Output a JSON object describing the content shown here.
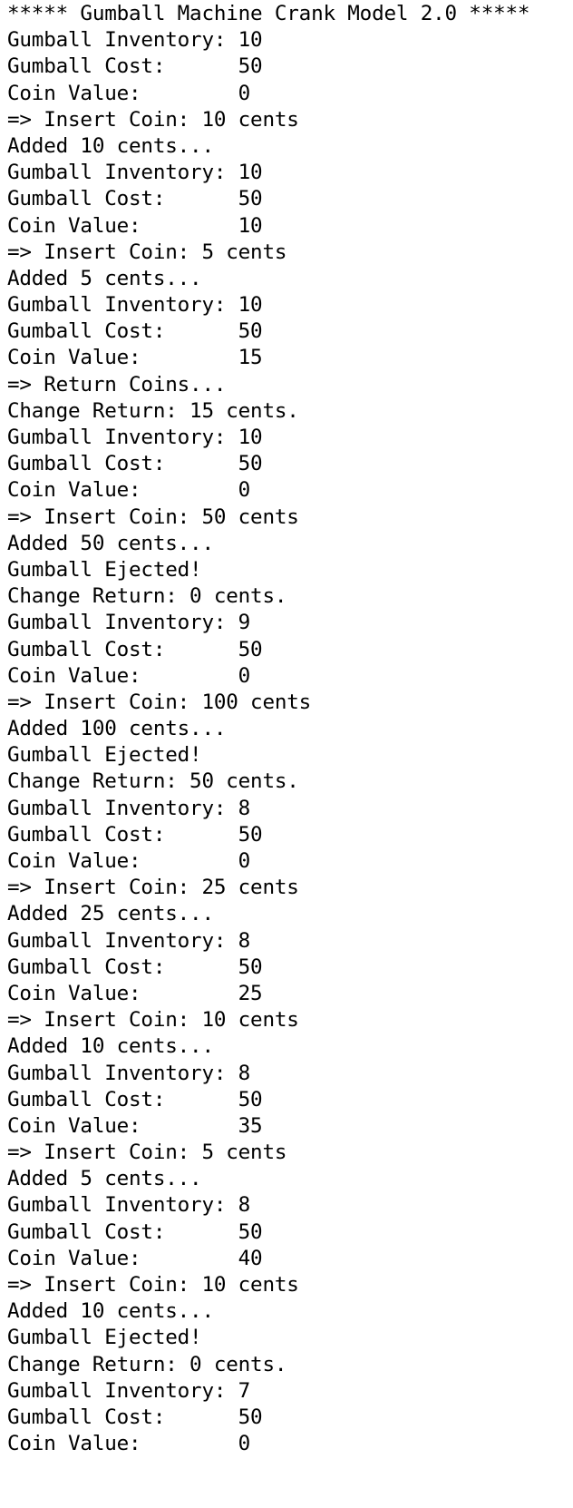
{
  "terminal": {
    "lines": [
      "***** Gumball Machine Crank Model 2.0 *****",
      "Gumball Inventory: 10",
      "Gumball Cost:      50",
      "Coin Value:        0",
      "=> Insert Coin: 10 cents",
      "Added 10 cents...",
      "Gumball Inventory: 10",
      "Gumball Cost:      50",
      "Coin Value:        10",
      "=> Insert Coin: 5 cents",
      "Added 5 cents...",
      "Gumball Inventory: 10",
      "Gumball Cost:      50",
      "Coin Value:        15",
      "=> Return Coins...",
      "Change Return: 15 cents.",
      "Gumball Inventory: 10",
      "Gumball Cost:      50",
      "Coin Value:        0",
      "=> Insert Coin: 50 cents",
      "Added 50 cents...",
      "Gumball Ejected!",
      "Change Return: 0 cents.",
      "Gumball Inventory: 9",
      "Gumball Cost:      50",
      "Coin Value:        0",
      "=> Insert Coin: 100 cents",
      "Added 100 cents...",
      "Gumball Ejected!",
      "Change Return: 50 cents.",
      "Gumball Inventory: 8",
      "Gumball Cost:      50",
      "Coin Value:        0",
      "=> Insert Coin: 25 cents",
      "Added 25 cents...",
      "Gumball Inventory: 8",
      "Gumball Cost:      50",
      "Coin Value:        25",
      "=> Insert Coin: 10 cents",
      "Added 10 cents...",
      "Gumball Inventory: 8",
      "Gumball Cost:      50",
      "Coin Value:        35",
      "=> Insert Coin: 5 cents",
      "Added 5 cents...",
      "Gumball Inventory: 8",
      "Gumball Cost:      50",
      "Coin Value:        40",
      "=> Insert Coin: 10 cents",
      "Added 10 cents...",
      "Gumball Ejected!",
      "Change Return: 0 cents.",
      "Gumball Inventory: 7",
      "Gumball Cost:      50",
      "Coin Value:        0"
    ]
  }
}
